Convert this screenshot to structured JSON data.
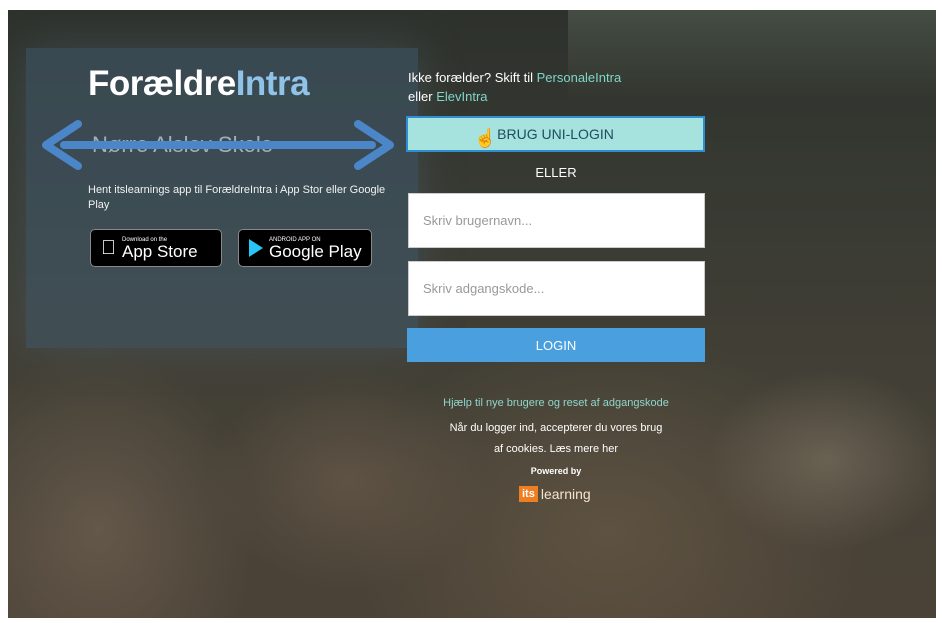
{
  "brand": {
    "part1": "Forældre",
    "part2": "Intra"
  },
  "school_name": "Nørre Alslev Skole",
  "app_promo": {
    "text": "Hent itslearnings app til ForældreIntra i App Stor eller Google Play",
    "app_store": {
      "small": "Download on the",
      "big": "App Store"
    },
    "google_play": {
      "small": "ANDROID APP ON",
      "big": "Google Play"
    }
  },
  "switch": {
    "prefix": "Ikke forælder? Skift til",
    "link1": "PersonaleIntra",
    "middle": "eller",
    "link2": "ElevIntra"
  },
  "login": {
    "uni_button": "BRUG UNI-LOGIN",
    "or_text": "ELLER",
    "username_placeholder": "Skriv brugernavn...",
    "password_placeholder": "Skriv adgangskode...",
    "login_button": "LOGIN"
  },
  "footer": {
    "help_link": "Hjælp til nye brugere og reset af adgangskode",
    "consent_line1": "Når du logger ind, accepterer du vores brug",
    "consent_line2": "af cookies. Læs mere her",
    "powered_by": "Powered by",
    "provider_box": "its",
    "provider_text": "learning"
  },
  "colors": {
    "uni_button_bg": "#a6e3de",
    "login_button_bg": "#4a9fdf",
    "link_color": "#7fd6c9",
    "arrow": "#4a86c8"
  }
}
